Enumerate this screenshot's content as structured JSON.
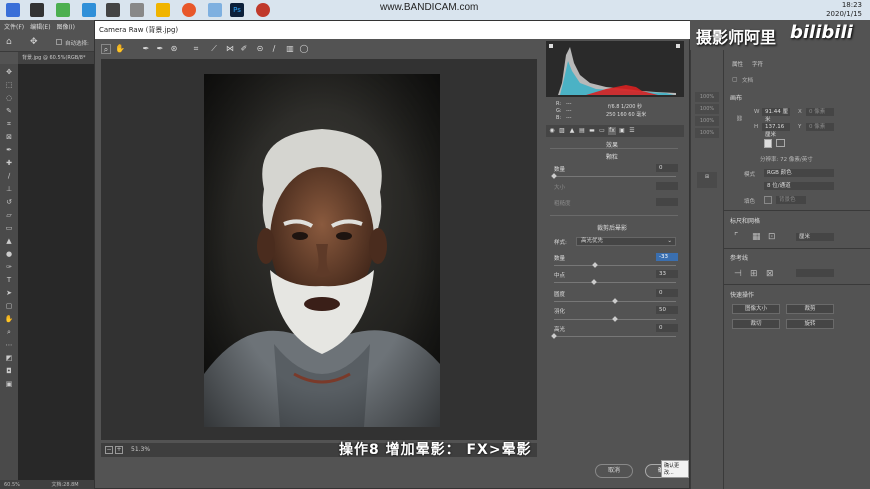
{
  "recorder_watermark": "www.BANDICAM.com",
  "clock": {
    "time": "18:23",
    "date": "2020/1/15"
  },
  "ps": {
    "menus": [
      "文件(F)",
      "编辑(E)",
      "图像(I)"
    ],
    "option_autoselect": "自动选择:",
    "doc_tab": "背景.jpg @ 60.5%(RGB/8*",
    "status_zoom": "60.5%",
    "status_doc": "文档:28.8M"
  },
  "camera_raw": {
    "title": "Camera Raw (背景.jpg)",
    "zoom": "51.3%",
    "readout": {
      "r_label": "R:",
      "g_label": "G:",
      "b_label": "B:",
      "r": "---",
      "g": "---",
      "b": "---",
      "line1": "f/6.8   1/200 秒",
      "line2": "250 160   60 毫米"
    },
    "panel": {
      "effects_title": "效果",
      "grain_title": "颗粒",
      "grain_rows": [
        {
          "label": "数量",
          "value": "0",
          "dim": false
        },
        {
          "label": "大小",
          "value": "",
          "dim": true
        },
        {
          "label": "粗糙度",
          "value": "",
          "dim": true
        }
      ],
      "vignette_title": "裁剪后晕影",
      "style_label": "样式:",
      "style_value": "高光优先",
      "vignette_rows": [
        {
          "label": "数量",
          "value": "-33",
          "active": true
        },
        {
          "label": "中点",
          "value": "33",
          "active": false
        },
        {
          "label": "圆度",
          "value": "0",
          "active": false
        },
        {
          "label": "羽化",
          "value": "50",
          "active": false
        },
        {
          "label": "高光",
          "value": "0",
          "active": false
        }
      ],
      "slider_levels": {
        "grain_amount": 0,
        "vig_amount": -33,
        "vig_midpoint": 33,
        "vig_roundness": 0,
        "vig_feather": 50,
        "vig_highlights": 0
      }
    },
    "cancel_label": "取消",
    "ok_label": "确定",
    "tooltip": "确认更改..."
  },
  "caption": "操作8 增加晕影： FX>晕影",
  "bilibili": {
    "title": "摄影师阿里",
    "logo": "bilibili"
  },
  "props": {
    "tab1": "属性",
    "tab2": "字符",
    "doc_label": "文档",
    "canvas_title": "画布",
    "w_label": "W",
    "w_value": "91.44 厘米",
    "h_label": "H",
    "h_value": "137.16 厘米",
    "x_label": "X",
    "x_value": "0 像素",
    "y_label": "Y",
    "y_value": "0 像素",
    "resolution": "分辨率: 72 像素/英寸",
    "mode_label": "模式",
    "mode_value": "RGB 颜色",
    "depth_value": "8 位/通道",
    "fill_label": "填色",
    "fill_value": "背景色",
    "rulers_title": "标尺和网格",
    "units_value": "厘米",
    "guides_title": "参考线",
    "quick_title": "快速操作",
    "quick_buttons": [
      "图像大小",
      "裁剪",
      "裁切",
      "旋转"
    ]
  },
  "left_col": [
    "100%",
    "100%",
    "100%",
    "100%"
  ]
}
